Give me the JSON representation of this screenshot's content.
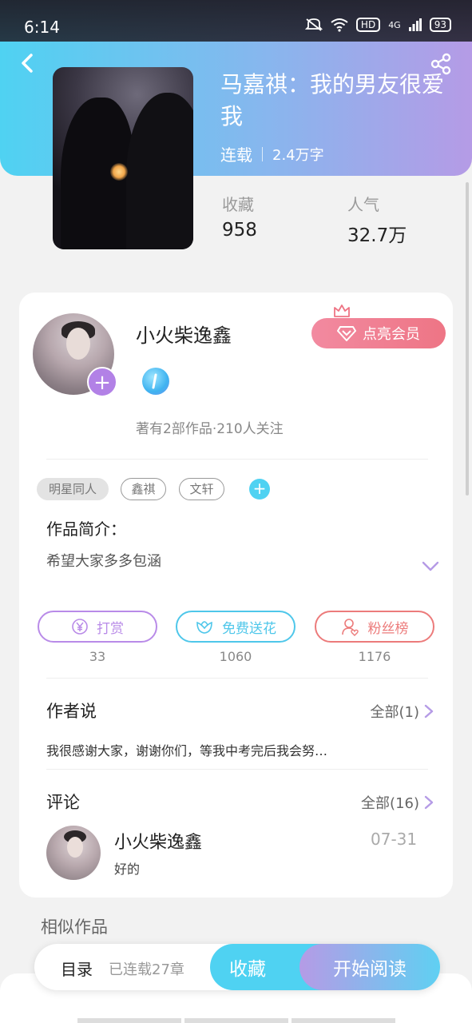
{
  "status_bar": {
    "time": "6:14",
    "network": "4G",
    "hd": "HD",
    "battery": "93"
  },
  "book": {
    "title": "马嘉祺：我的男友很爱我",
    "status": "连载",
    "word_count": "2.4万字"
  },
  "stats": [
    {
      "label": "收藏",
      "value": "958"
    },
    {
      "label": "人气",
      "value": "32.7万"
    }
  ],
  "author": {
    "name": "小火柴逸鑫",
    "vip_button": "点亮会员",
    "summary": "著有2部作品·210人关注"
  },
  "tags": [
    "明星同人",
    "鑫祺",
    "文轩"
  ],
  "intro": {
    "label": "作品简介：",
    "text": "希望大家多多包涵"
  },
  "actions": [
    {
      "label": "打赏",
      "count": "33",
      "icon": "yen-icon",
      "color": "#b98be8"
    },
    {
      "label": "免费送花",
      "count": "1060",
      "icon": "flower-icon",
      "color": "#4fc7ea"
    },
    {
      "label": "粉丝榜",
      "count": "1176",
      "icon": "fan-rank-icon",
      "color": "#ec7b7b"
    }
  ],
  "author_say": {
    "title": "作者说",
    "link": "全部(1)",
    "text": "我很感谢大家，谢谢你们，等我中考完后我会努…"
  },
  "comments": {
    "title": "评论",
    "link": "全部(16)",
    "items": [
      {
        "name": "小火柴逸鑫",
        "date": "07-31",
        "text": "好的"
      }
    ]
  },
  "similar": {
    "title": "相似作品"
  },
  "bottom_bar": {
    "toc": "目录",
    "chapters": "已连载27章",
    "favorite": "收藏",
    "read": "开始阅读"
  },
  "colors": {
    "accent": "#4fd2f2",
    "purple": "#b59be6",
    "vip": "#ee7585"
  }
}
